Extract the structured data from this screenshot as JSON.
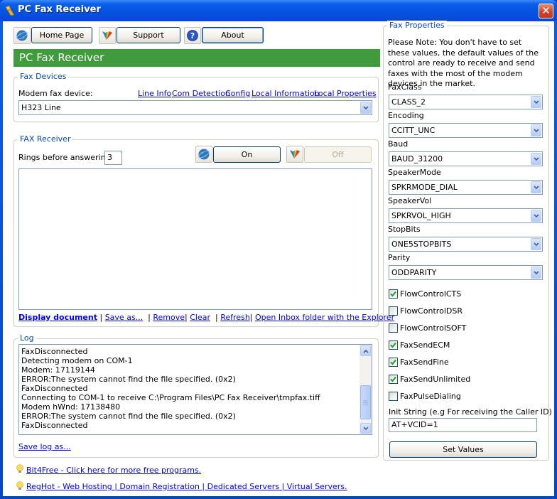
{
  "window": {
    "title": "PC Fax Receiver",
    "close_icon": "close-icon"
  },
  "toolbar": {
    "home_label": "Home Page",
    "support_label": "Support",
    "about_label": "About",
    "icons": [
      "globe-icon",
      "butterfly-icon",
      "help-icon"
    ]
  },
  "banner": {
    "title": "PC Fax Receiver",
    "color": "#3f9b3b"
  },
  "fax_devices": {
    "legend": "Fax Devices",
    "label": "Modem fax device:",
    "links": [
      "Line Info",
      "Com Detection",
      "Config",
      "Local Information",
      "Local Properties"
    ],
    "selected_device": "H323 Line"
  },
  "fax_receiver": {
    "legend": "FAX Receiver",
    "rings_label": "Rings before answering:",
    "rings_value": "3",
    "on_label": "On",
    "off_label": "Off",
    "links": {
      "display": "Display document",
      "save_as": "Save as...",
      "remove": "Remove",
      "clear": "Clear",
      "refresh": "Refresh",
      "open_inbox": "Open Inbox folder with the Explorer"
    },
    "separator": "|"
  },
  "log": {
    "legend": "Log",
    "lines": [
      "FaxDisconnected",
      "Detecting modem on COM-1",
      "Modem: 17119144",
      "ERROR:The system cannot find the file specified. (0x2)",
      "FaxDisconnected",
      "Connecting to COM-1 to receive C:\\Program Files\\PC Fax Receiver\\tmpfax.tiff",
      "Modem hWnd: 17138480",
      "ERROR:The system cannot find the file specified. (0x2)",
      "FaxDisconnected"
    ],
    "save_link": "Save log as...",
    "scroll_position": 0.85
  },
  "footer": {
    "links": [
      "Bit4Free - Click here for more free programs.",
      "RegHot - Web Hosting | Domain Registration | Dedicated Servers | Virtual Servers."
    ]
  },
  "fax_properties": {
    "legend": "Fax Properties",
    "note": "Please Note: You don't have to set these values, the default values of the control are ready to receive and send faxes with the most of the modem devices in the market.",
    "fields": [
      {
        "label": "FaxClass",
        "value": "CLASS_2"
      },
      {
        "label": "Encoding",
        "value": "CCITT_UNC"
      },
      {
        "label": "Baud",
        "value": "BAUD_31200"
      },
      {
        "label": "SpeakerMode",
        "value": "SPKRMODE_DIAL"
      },
      {
        "label": "SpeakerVol",
        "value": "SPKRVOL_HIGH"
      },
      {
        "label": "StopBits",
        "value": "ONE5STOPBITS"
      },
      {
        "label": "Parity",
        "value": "ODDPARITY"
      }
    ],
    "checkboxes": [
      {
        "label": "FlowControlCTS",
        "checked": true
      },
      {
        "label": "FlowControlDSR",
        "checked": false
      },
      {
        "label": "FlowControlSOFT",
        "checked": false
      },
      {
        "label": "FaxSendECM",
        "checked": true
      },
      {
        "label": "FaxSendFine",
        "checked": true
      },
      {
        "label": "FaxSendUnlimited",
        "checked": true
      },
      {
        "label": "FaxPulseDialing",
        "checked": false
      }
    ],
    "init_label": "Init String (e.g For receiving the Caller ID)",
    "init_value": "AT+VCID=1",
    "set_values_label": "Set Values"
  }
}
